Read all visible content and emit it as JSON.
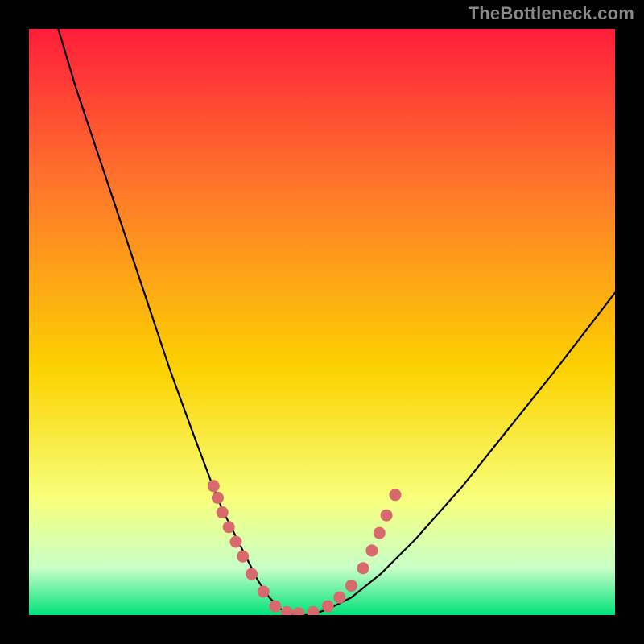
{
  "watermark": "TheBottleneck.com",
  "colors": {
    "background": "#000000",
    "gradient_top": "#ff1d3a",
    "gradient_mid_upper": "#ff7a2a",
    "gradient_mid": "#fcd200",
    "gradient_lower": "#f8ff7a",
    "gradient_pale": "#c8ffc8",
    "gradient_bottom": "#00e27a",
    "curve": "#000000",
    "dots": "#d86a6e"
  },
  "chart_data": {
    "type": "line",
    "title": "",
    "xlabel": "",
    "ylabel": "",
    "xlim": [
      0,
      100
    ],
    "ylim": [
      0,
      100
    ],
    "grid": false,
    "legend": false,
    "series": [
      {
        "name": "bottleneck-curve",
        "x": [
          5,
          8,
          12,
          16,
          20,
          24,
          28,
          31,
          33,
          35,
          37,
          39,
          41,
          43,
          45,
          48,
          51,
          55,
          60,
          66,
          74,
          82,
          90,
          100
        ],
        "y": [
          100,
          90,
          78,
          66,
          54,
          42,
          31,
          23,
          18,
          14,
          10,
          6,
          3,
          1,
          0,
          0,
          1,
          3,
          7,
          13,
          22,
          32,
          42,
          55
        ]
      }
    ],
    "annotations": [],
    "markers": {
      "name": "cluster-dots",
      "x": [
        31.5,
        32.2,
        33.0,
        34.1,
        35.3,
        36.5,
        38.0,
        40.0,
        42.0,
        44.0,
        46.0,
        48.5,
        51.0,
        53.0,
        55.0,
        57.0,
        58.5,
        59.8,
        61.0,
        62.5
      ],
      "y": [
        22.0,
        20.0,
        17.5,
        15.0,
        12.5,
        10.0,
        7.0,
        4.0,
        1.5,
        0.5,
        0.3,
        0.5,
        1.5,
        3.0,
        5.0,
        8.0,
        11.0,
        14.0,
        17.0,
        20.5
      ]
    }
  }
}
